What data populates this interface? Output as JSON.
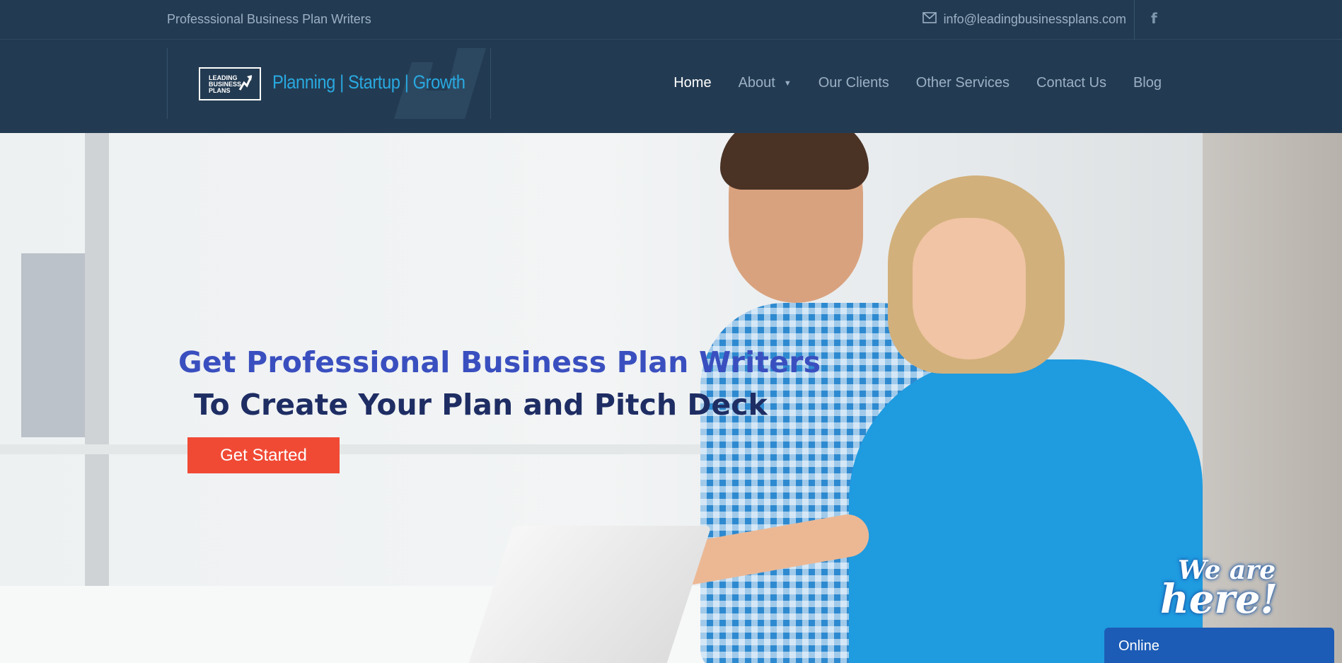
{
  "topbar": {
    "tagline": "Professsional Business Plan Writers",
    "email": "info@leadingbusinessplans.com",
    "email_icon": "envelope-icon",
    "social_icon": "facebook-icon"
  },
  "header": {
    "logo_line1": "LEADING",
    "logo_line2": "BUSINESS",
    "logo_line3": "PLANS",
    "logo_tagline": "Planning | Startup | Growth",
    "nav": [
      {
        "label": "Home",
        "active": true
      },
      {
        "label": "About",
        "has_dropdown": true
      },
      {
        "label": "Our Clients"
      },
      {
        "label": "Other Services"
      },
      {
        "label": "Contact Us"
      },
      {
        "label": "Blog"
      }
    ]
  },
  "hero": {
    "headline": "Get Professional Business Plan Writers",
    "subline": "To Create Your Plan and Pitch Deck",
    "cta_label": "Get Started"
  },
  "chat": {
    "badge_line1": "We are",
    "badge_line2": "here!",
    "status": "Online"
  },
  "colors": {
    "header_bg": "#233b52",
    "accent_blue": "#29a9e0",
    "headline_blue": "#3a4fbf",
    "cta_red": "#f04a35",
    "chat_blue": "#1d5cb6"
  }
}
